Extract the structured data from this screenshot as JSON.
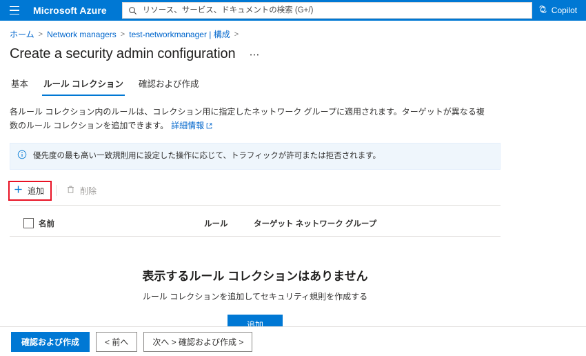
{
  "topbar": {
    "menu_icon": "hamburger-icon",
    "brand": "Microsoft Azure",
    "search": {
      "icon": "search-icon",
      "placeholder": "リソース、サービス、ドキュメントの検索 (G+/)",
      "value": ""
    },
    "copilot": {
      "icon": "copilot-icon",
      "label": "Copilot"
    },
    "cloud_shell": {
      "icon": "cloud-shell-icon"
    },
    "accent_color": "#0078d4"
  },
  "breadcrumb": {
    "items": [
      {
        "label": "ホーム"
      },
      {
        "label": "Network managers"
      },
      {
        "label": "test-networkmanager | 構成"
      }
    ],
    "separator": ">",
    "link_color": "#0066cc"
  },
  "header": {
    "title": "Create a security admin configuration",
    "more_label": "⋯"
  },
  "tabs": [
    {
      "label": "基本",
      "active": false
    },
    {
      "label": "ルール コレクション",
      "active": true
    },
    {
      "label": "確認および作成",
      "active": false
    }
  ],
  "description": {
    "text": "各ルール コレクション内のルールは、コレクション用に指定したネットワーク グループに適用されます。ターゲットが異なる複数のルール コレクションを追加できます。",
    "link_label": "詳細情報",
    "link_icon": "external-link-icon"
  },
  "info_banner": {
    "icon": "info-icon",
    "message": "優先度の最も高い一致規則用に設定した操作に応じて、トラフィックが許可または拒否されます。",
    "background": "#eff6fc"
  },
  "command_bar": {
    "add": {
      "icon": "plus-icon",
      "label": "追加",
      "highlighted": true,
      "highlight_color": "#e81123"
    },
    "delete": {
      "icon": "trash-icon",
      "label": "削除",
      "disabled": true
    }
  },
  "table": {
    "select_all": {
      "icon": "checkbox-unchecked"
    },
    "columns": [
      {
        "label": "名前"
      },
      {
        "label": "ルール"
      },
      {
        "label": "ターゲット ネットワーク グループ"
      }
    ],
    "rows": []
  },
  "empty_state": {
    "title": "表示するルール コレクションはありません",
    "subtitle": "ルール コレクションを追加してセキュリティ規則を作成する",
    "button_label": "追加"
  },
  "footer": {
    "review_create": "確認および作成",
    "previous": "< 前へ",
    "next": "次へ > 確認および作成 >"
  }
}
